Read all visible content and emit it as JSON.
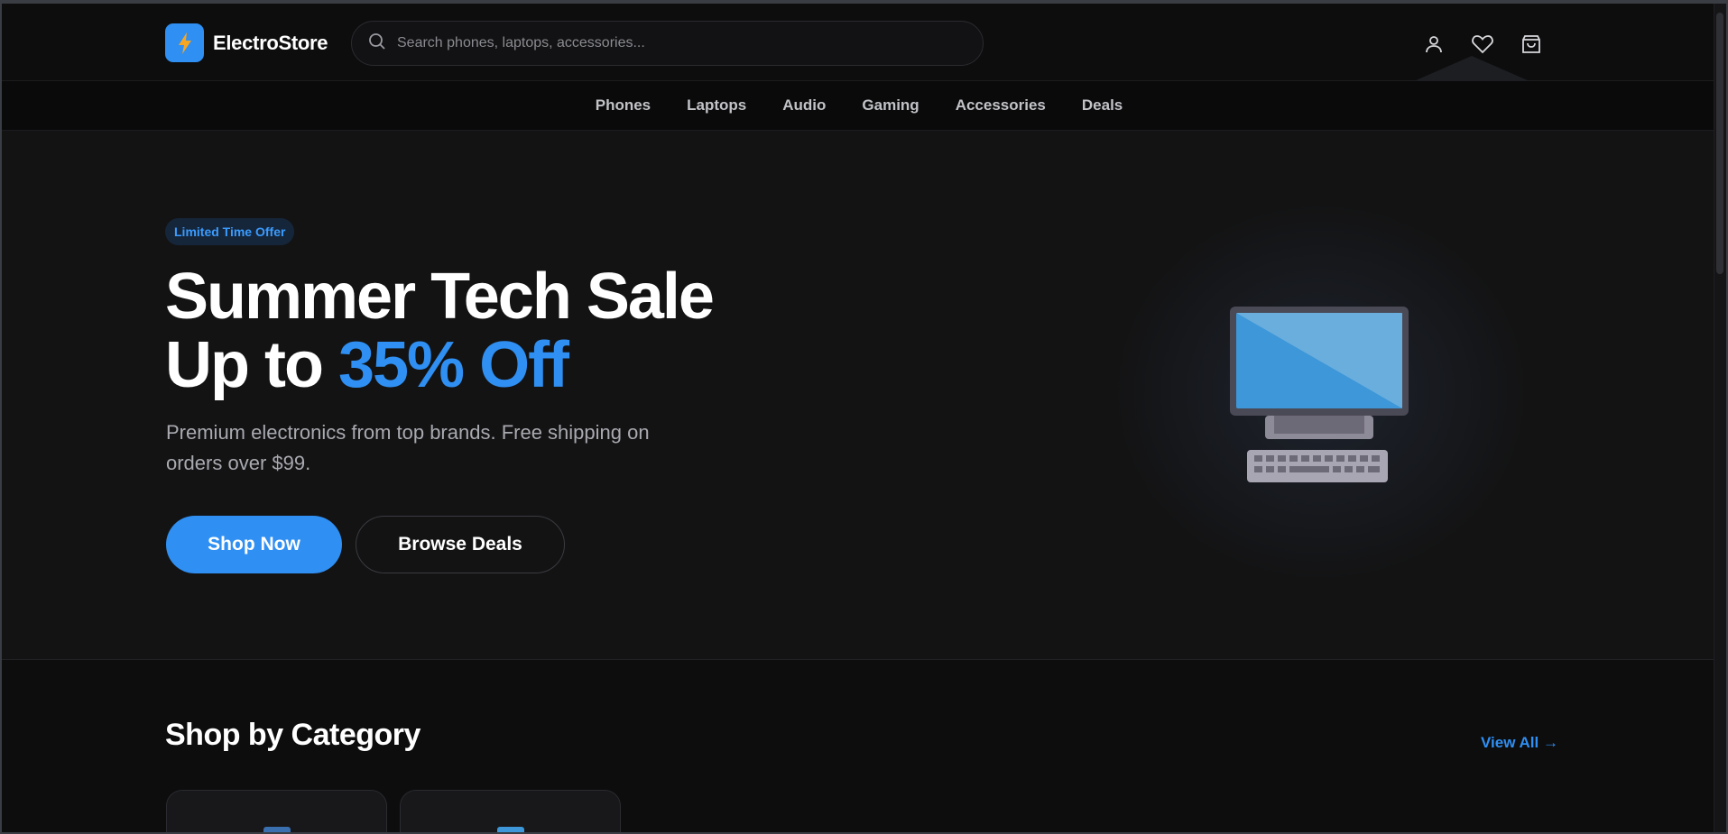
{
  "header": {
    "logo_text": "ElectroStore",
    "search_placeholder": "Search phones, laptops, accessories..."
  },
  "nav": {
    "items": [
      "Phones",
      "Laptops",
      "Audio",
      "Gaming",
      "Accessories",
      "Deals"
    ]
  },
  "hero": {
    "badge": "Limited Time Offer",
    "title_line1": "Summer Tech Sale",
    "title_line2_prefix": "Up to ",
    "title_line2_accent": "35% Off",
    "subtitle": "Premium electronics from top brands. Free shipping on orders over $99.",
    "primary_button": "Shop Now",
    "secondary_button": "Browse Deals"
  },
  "categories": {
    "title": "Shop by Category",
    "view_all": "View All →"
  },
  "colors": {
    "accent": "#2f8ff2",
    "background": "#0d0d0e",
    "hero_background": "#131314"
  },
  "icons": {
    "logo": "lightning-bolt-icon",
    "search": "search-icon",
    "account": "user-icon",
    "wishlist": "heart-icon",
    "cart": "shopping-bag-icon",
    "hero_art": "desktop-computer-icon"
  }
}
